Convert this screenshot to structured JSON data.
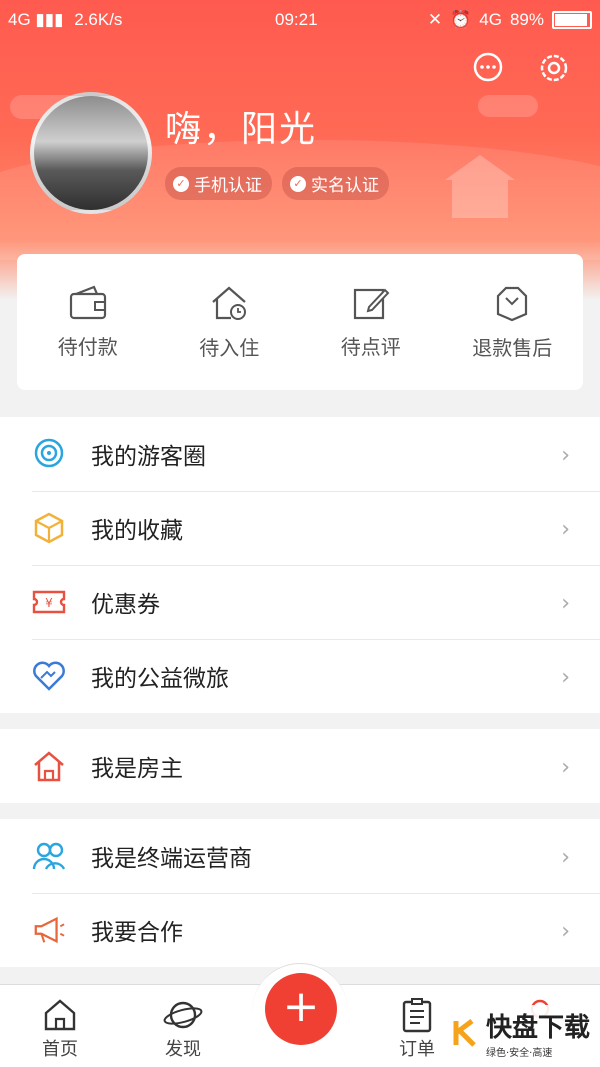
{
  "status_bar": {
    "network": "4G",
    "speed": "2.6K/s",
    "time": "09:21",
    "network_right": "4G",
    "battery": "89%",
    "battery_level": 0.89
  },
  "header": {
    "username": "嗨，阳光",
    "badges": [
      "手机认证",
      "实名认证"
    ],
    "icons": [
      "message-icon",
      "settings-icon"
    ]
  },
  "orders": [
    {
      "label": "待付款",
      "icon": "wallet-icon"
    },
    {
      "label": "待入住",
      "icon": "home-clock-icon"
    },
    {
      "label": "待点评",
      "icon": "edit-icon"
    },
    {
      "label": "退款售后",
      "icon": "refund-icon"
    }
  ],
  "menu_group1": [
    {
      "label": "我的游客圈",
      "icon": "chat-bubble-icon",
      "color": "#2aa5e0"
    },
    {
      "label": "我的收藏",
      "icon": "box-icon",
      "color": "#f2b23a"
    },
    {
      "label": "优惠券",
      "icon": "coupon-icon",
      "color": "#e85040"
    },
    {
      "label": "我的公益微旅",
      "icon": "heart-icon",
      "color": "#3a7bd5"
    }
  ],
  "menu_group2": [
    {
      "label": "我是房主",
      "icon": "house-icon",
      "color": "#e85040"
    }
  ],
  "menu_group3": [
    {
      "label": "我是终端运营商",
      "icon": "users-icon",
      "color": "#2aa5e0"
    },
    {
      "label": "我要合作",
      "icon": "megaphone-icon",
      "color": "#e8663a"
    }
  ],
  "tabbar": {
    "items": [
      "首页",
      "发现",
      "订单"
    ],
    "fab": "+"
  },
  "watermark": {
    "main": "快盘下载",
    "sub": "绿色·安全·高速"
  },
  "colors": {
    "accent": "#f03f33",
    "header_top": "#ff5a4f",
    "header_bottom": "#ff8b6c"
  }
}
